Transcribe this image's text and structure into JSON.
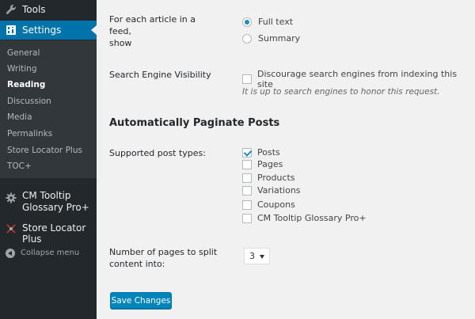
{
  "sidebar": {
    "tools_label": "Tools",
    "settings_label": "Settings",
    "submenu": [
      "General",
      "Writing",
      "Reading",
      "Discussion",
      "Media",
      "Permalinks",
      "Store Locator Plus",
      "TOC+"
    ],
    "current": "Reading",
    "cm_tooltip_line1": "CM Tooltip",
    "cm_tooltip_line2": "Glossary Pro+",
    "store_locator_label": "Store Locator Plus",
    "collapse_label": "Collapse menu"
  },
  "feed": {
    "label_line1": "For each article in a feed,",
    "label_line2": "show",
    "full_text": "Full text",
    "summary": "Summary",
    "selected": "Full text"
  },
  "visibility": {
    "label": "Search Engine Visibility",
    "checkbox_label": "Discourage search engines from indexing this site",
    "hint": "It is up to search engines to honor this request."
  },
  "paginate": {
    "section_title": "Automatically Paginate Posts",
    "post_types_label": "Supported post types:",
    "post_types": [
      "Posts",
      "Pages",
      "Products",
      "Variations",
      "Coupons",
      "CM Tooltip Glossary Pro+"
    ],
    "pages_label_line1": "Number of pages to split",
    "pages_label_line2": "content into:",
    "pages_value": "3"
  },
  "save_label": "Save Changes",
  "colors": {
    "sidebar_bg": "#23282d",
    "submenu_bg": "#32373c",
    "accent": "#0073aa",
    "button": "#0085ba"
  }
}
